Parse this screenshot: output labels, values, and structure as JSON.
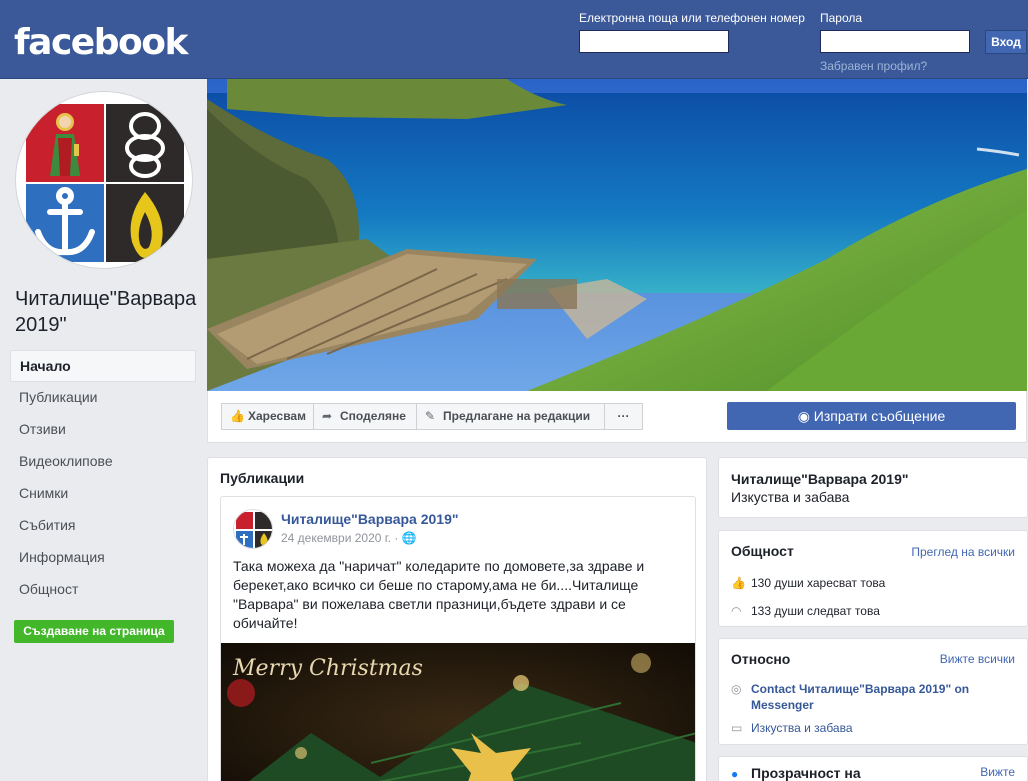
{
  "header": {
    "logo": "facebook",
    "email_label": "Електронна поща или телефонен номер",
    "password_label": "Парола",
    "login_button": "Вход",
    "forgot_link": "Забравен профил?"
  },
  "sidebar": {
    "page_name": "Читалище\"Варвара 2019\"",
    "items": [
      {
        "label": "Начало"
      },
      {
        "label": "Публикации"
      },
      {
        "label": "Отзиви"
      },
      {
        "label": "Видеоклипове"
      },
      {
        "label": "Снимки"
      },
      {
        "label": "Събития"
      },
      {
        "label": "Информация"
      },
      {
        "label": "Общност"
      }
    ],
    "create_page": "Създаване на страница"
  },
  "actions": {
    "like": "Харесвам",
    "share": "Споделяне",
    "suggest": "Предлагане на редакции",
    "more": "···",
    "message": "Изпрати съобщение"
  },
  "posts": {
    "title": "Публикации",
    "post": {
      "author": "Читалище\"Варвара 2019\"",
      "date": "24 декември 2020 г. ·",
      "text": "Така можеха да \"наричат\" коледарите по домовете,за здраве и берекет,ако всичко си беше по старому,ама не би....Читалище \"Варвара\" ви пожелава светли празници,бъдете здрави и се обичайте!",
      "image_text": "Merry Christmas"
    }
  },
  "about_card": {
    "name": "Читалище\"Варвара 2019\"",
    "category": "Изкуства и забава"
  },
  "community": {
    "title": "Общност",
    "see_all": "Преглед на всички",
    "likes": "130 души харесват това",
    "follows": "133 души следват това"
  },
  "about": {
    "title": "Относно",
    "see_all": "Вижте всички",
    "messenger": "Contact Читалище\"Варвара 2019\" on Messenger",
    "category": "Изкуства и забава"
  },
  "transparency": {
    "title": "Прозрачност на",
    "see_all": "Вижте"
  },
  "colors": {
    "brand": "#3b5998",
    "button": "#4267b2",
    "green": "#42b72a"
  }
}
